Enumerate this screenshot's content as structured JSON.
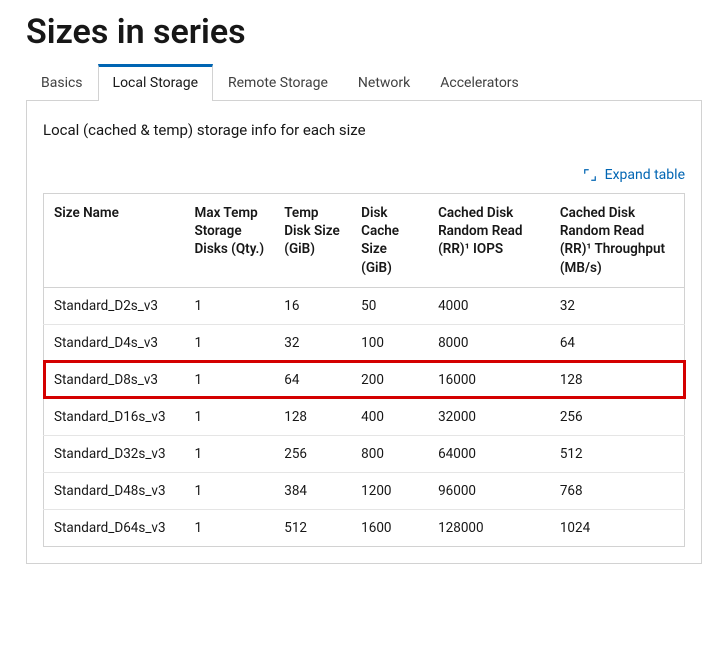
{
  "title": "Sizes in series",
  "tabs": [
    "Basics",
    "Local Storage",
    "Remote Storage",
    "Network",
    "Accelerators"
  ],
  "active_tab_index": 1,
  "description": "Local (cached & temp) storage info for each size",
  "expand_label": "Expand table",
  "columns": [
    "Size Name",
    "Max Temp Storage Disks (Qty.)",
    "Temp Disk Size (GiB)",
    "Disk Cache Size (GiB)",
    "Cached Disk Random Read (RR)¹ IOPS",
    "Cached Disk Random Read (RR)¹ Throughput (MB/s)"
  ],
  "highlight_row_index": 2,
  "rows": [
    {
      "name": "Standard_D2s_v3",
      "qty": "1",
      "temp": "16",
      "cache": "50",
      "iops": "4000",
      "tput": "32"
    },
    {
      "name": "Standard_D4s_v3",
      "qty": "1",
      "temp": "32",
      "cache": "100",
      "iops": "8000",
      "tput": "64"
    },
    {
      "name": "Standard_D8s_v3",
      "qty": "1",
      "temp": "64",
      "cache": "200",
      "iops": "16000",
      "tput": "128"
    },
    {
      "name": "Standard_D16s_v3",
      "qty": "1",
      "temp": "128",
      "cache": "400",
      "iops": "32000",
      "tput": "256"
    },
    {
      "name": "Standard_D32s_v3",
      "qty": "1",
      "temp": "256",
      "cache": "800",
      "iops": "64000",
      "tput": "512"
    },
    {
      "name": "Standard_D48s_v3",
      "qty": "1",
      "temp": "384",
      "cache": "1200",
      "iops": "96000",
      "tput": "768"
    },
    {
      "name": "Standard_D64s_v3",
      "qty": "1",
      "temp": "512",
      "cache": "1600",
      "iops": "128000",
      "tput": "1024"
    }
  ]
}
